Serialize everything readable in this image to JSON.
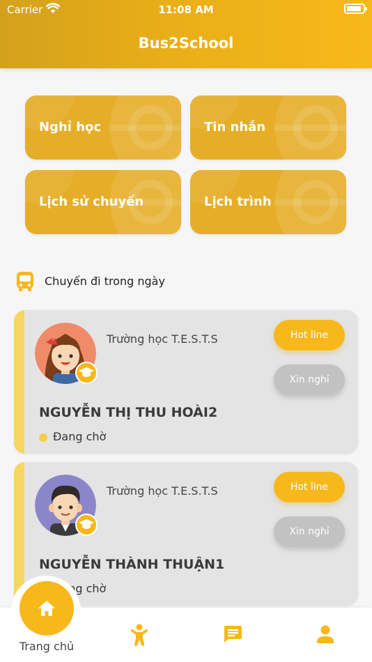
{
  "status_bar": {
    "carrier": "Carrier",
    "time": "11:08 AM"
  },
  "header": {
    "title": "Bus2School"
  },
  "menu": [
    {
      "label": "Nghỉ học"
    },
    {
      "label": "Tin nhắn"
    },
    {
      "label": "Lịch sử chuyến"
    },
    {
      "label": "Lịch trình"
    }
  ],
  "section": {
    "title": "Chuyến đi trong ngày"
  },
  "trips": [
    {
      "school": "Trường học T.E.S.T.S",
      "name": "NGUYỄN THỊ THU HOÀI2",
      "status": "Đang chờ",
      "hotline_label": "Hot line",
      "leave_label": "Xin nghỉ"
    },
    {
      "school": "Trường học T.E.S.T.S",
      "name": "NGUYỄN THÀNH THUẬN1",
      "status": "Đang chờ",
      "hotline_label": "Hot line",
      "leave_label": "Xin nghỉ"
    }
  ],
  "tabbar": {
    "home_label": "Trang chủ"
  },
  "colors": {
    "primary": "#f7b81b",
    "tile": "#e6ae28",
    "accent": "#f6d663",
    "disabled": "#c2c2c2"
  }
}
